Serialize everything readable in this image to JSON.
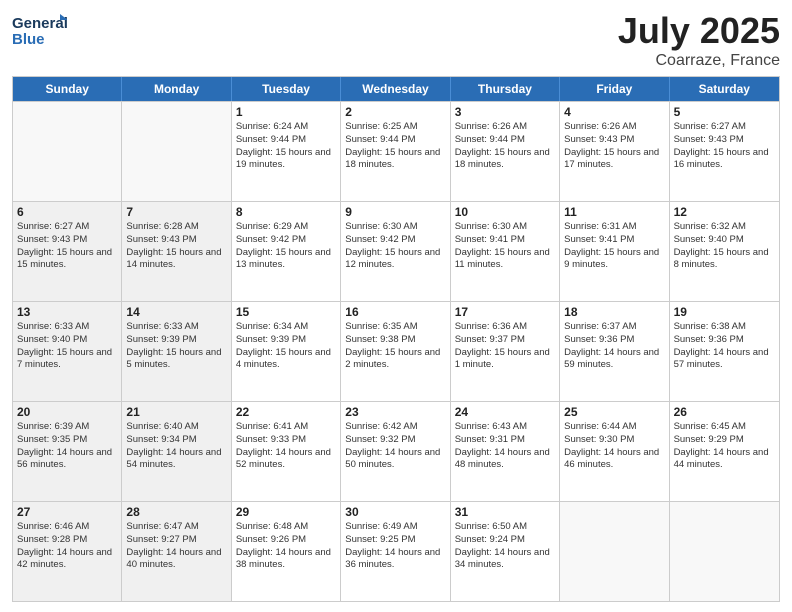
{
  "header": {
    "logo_line1": "General",
    "logo_line2": "Blue",
    "title": "July 2025",
    "subtitle": "Coarraze, France"
  },
  "weekdays": [
    "Sunday",
    "Monday",
    "Tuesday",
    "Wednesday",
    "Thursday",
    "Friday",
    "Saturday"
  ],
  "weeks": [
    [
      {
        "day": "",
        "sunrise": "",
        "sunset": "",
        "daylight": "",
        "shaded": true
      },
      {
        "day": "",
        "sunrise": "",
        "sunset": "",
        "daylight": "",
        "shaded": true
      },
      {
        "day": "1",
        "sunrise": "Sunrise: 6:24 AM",
        "sunset": "Sunset: 9:44 PM",
        "daylight": "Daylight: 15 hours and 19 minutes.",
        "shaded": false
      },
      {
        "day": "2",
        "sunrise": "Sunrise: 6:25 AM",
        "sunset": "Sunset: 9:44 PM",
        "daylight": "Daylight: 15 hours and 18 minutes.",
        "shaded": false
      },
      {
        "day": "3",
        "sunrise": "Sunrise: 6:26 AM",
        "sunset": "Sunset: 9:44 PM",
        "daylight": "Daylight: 15 hours and 18 minutes.",
        "shaded": false
      },
      {
        "day": "4",
        "sunrise": "Sunrise: 6:26 AM",
        "sunset": "Sunset: 9:43 PM",
        "daylight": "Daylight: 15 hours and 17 minutes.",
        "shaded": false
      },
      {
        "day": "5",
        "sunrise": "Sunrise: 6:27 AM",
        "sunset": "Sunset: 9:43 PM",
        "daylight": "Daylight: 15 hours and 16 minutes.",
        "shaded": false
      }
    ],
    [
      {
        "day": "6",
        "sunrise": "Sunrise: 6:27 AM",
        "sunset": "Sunset: 9:43 PM",
        "daylight": "Daylight: 15 hours and 15 minutes.",
        "shaded": true
      },
      {
        "day": "7",
        "sunrise": "Sunrise: 6:28 AM",
        "sunset": "Sunset: 9:43 PM",
        "daylight": "Daylight: 15 hours and 14 minutes.",
        "shaded": true
      },
      {
        "day": "8",
        "sunrise": "Sunrise: 6:29 AM",
        "sunset": "Sunset: 9:42 PM",
        "daylight": "Daylight: 15 hours and 13 minutes.",
        "shaded": false
      },
      {
        "day": "9",
        "sunrise": "Sunrise: 6:30 AM",
        "sunset": "Sunset: 9:42 PM",
        "daylight": "Daylight: 15 hours and 12 minutes.",
        "shaded": false
      },
      {
        "day": "10",
        "sunrise": "Sunrise: 6:30 AM",
        "sunset": "Sunset: 9:41 PM",
        "daylight": "Daylight: 15 hours and 11 minutes.",
        "shaded": false
      },
      {
        "day": "11",
        "sunrise": "Sunrise: 6:31 AM",
        "sunset": "Sunset: 9:41 PM",
        "daylight": "Daylight: 15 hours and 9 minutes.",
        "shaded": false
      },
      {
        "day": "12",
        "sunrise": "Sunrise: 6:32 AM",
        "sunset": "Sunset: 9:40 PM",
        "daylight": "Daylight: 15 hours and 8 minutes.",
        "shaded": false
      }
    ],
    [
      {
        "day": "13",
        "sunrise": "Sunrise: 6:33 AM",
        "sunset": "Sunset: 9:40 PM",
        "daylight": "Daylight: 15 hours and 7 minutes.",
        "shaded": true
      },
      {
        "day": "14",
        "sunrise": "Sunrise: 6:33 AM",
        "sunset": "Sunset: 9:39 PM",
        "daylight": "Daylight: 15 hours and 5 minutes.",
        "shaded": true
      },
      {
        "day": "15",
        "sunrise": "Sunrise: 6:34 AM",
        "sunset": "Sunset: 9:39 PM",
        "daylight": "Daylight: 15 hours and 4 minutes.",
        "shaded": false
      },
      {
        "day": "16",
        "sunrise": "Sunrise: 6:35 AM",
        "sunset": "Sunset: 9:38 PM",
        "daylight": "Daylight: 15 hours and 2 minutes.",
        "shaded": false
      },
      {
        "day": "17",
        "sunrise": "Sunrise: 6:36 AM",
        "sunset": "Sunset: 9:37 PM",
        "daylight": "Daylight: 15 hours and 1 minute.",
        "shaded": false
      },
      {
        "day": "18",
        "sunrise": "Sunrise: 6:37 AM",
        "sunset": "Sunset: 9:36 PM",
        "daylight": "Daylight: 14 hours and 59 minutes.",
        "shaded": false
      },
      {
        "day": "19",
        "sunrise": "Sunrise: 6:38 AM",
        "sunset": "Sunset: 9:36 PM",
        "daylight": "Daylight: 14 hours and 57 minutes.",
        "shaded": false
      }
    ],
    [
      {
        "day": "20",
        "sunrise": "Sunrise: 6:39 AM",
        "sunset": "Sunset: 9:35 PM",
        "daylight": "Daylight: 14 hours and 56 minutes.",
        "shaded": true
      },
      {
        "day": "21",
        "sunrise": "Sunrise: 6:40 AM",
        "sunset": "Sunset: 9:34 PM",
        "daylight": "Daylight: 14 hours and 54 minutes.",
        "shaded": true
      },
      {
        "day": "22",
        "sunrise": "Sunrise: 6:41 AM",
        "sunset": "Sunset: 9:33 PM",
        "daylight": "Daylight: 14 hours and 52 minutes.",
        "shaded": false
      },
      {
        "day": "23",
        "sunrise": "Sunrise: 6:42 AM",
        "sunset": "Sunset: 9:32 PM",
        "daylight": "Daylight: 14 hours and 50 minutes.",
        "shaded": false
      },
      {
        "day": "24",
        "sunrise": "Sunrise: 6:43 AM",
        "sunset": "Sunset: 9:31 PM",
        "daylight": "Daylight: 14 hours and 48 minutes.",
        "shaded": false
      },
      {
        "day": "25",
        "sunrise": "Sunrise: 6:44 AM",
        "sunset": "Sunset: 9:30 PM",
        "daylight": "Daylight: 14 hours and 46 minutes.",
        "shaded": false
      },
      {
        "day": "26",
        "sunrise": "Sunrise: 6:45 AM",
        "sunset": "Sunset: 9:29 PM",
        "daylight": "Daylight: 14 hours and 44 minutes.",
        "shaded": false
      }
    ],
    [
      {
        "day": "27",
        "sunrise": "Sunrise: 6:46 AM",
        "sunset": "Sunset: 9:28 PM",
        "daylight": "Daylight: 14 hours and 42 minutes.",
        "shaded": true
      },
      {
        "day": "28",
        "sunrise": "Sunrise: 6:47 AM",
        "sunset": "Sunset: 9:27 PM",
        "daylight": "Daylight: 14 hours and 40 minutes.",
        "shaded": true
      },
      {
        "day": "29",
        "sunrise": "Sunrise: 6:48 AM",
        "sunset": "Sunset: 9:26 PM",
        "daylight": "Daylight: 14 hours and 38 minutes.",
        "shaded": false
      },
      {
        "day": "30",
        "sunrise": "Sunrise: 6:49 AM",
        "sunset": "Sunset: 9:25 PM",
        "daylight": "Daylight: 14 hours and 36 minutes.",
        "shaded": false
      },
      {
        "day": "31",
        "sunrise": "Sunrise: 6:50 AM",
        "sunset": "Sunset: 9:24 PM",
        "daylight": "Daylight: 14 hours and 34 minutes.",
        "shaded": false
      },
      {
        "day": "",
        "sunrise": "",
        "sunset": "",
        "daylight": "",
        "shaded": false
      },
      {
        "day": "",
        "sunrise": "",
        "sunset": "",
        "daylight": "",
        "shaded": false
      }
    ]
  ]
}
